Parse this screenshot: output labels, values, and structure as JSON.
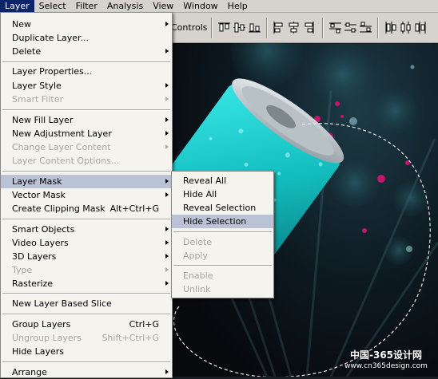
{
  "menubar": {
    "items": [
      {
        "label": "Layer"
      },
      {
        "label": "Select"
      },
      {
        "label": "Filter"
      },
      {
        "label": "Analysis"
      },
      {
        "label": "View"
      },
      {
        "label": "Window"
      },
      {
        "label": "Help"
      }
    ]
  },
  "options_bar": {
    "label_fragment": "Controls"
  },
  "layer_menu": {
    "items": [
      {
        "label": "New"
      },
      {
        "label": "Duplicate Layer..."
      },
      {
        "label": "Delete"
      },
      {
        "label": "Layer Properties..."
      },
      {
        "label": "Layer Style"
      },
      {
        "label": "Smart Filter"
      },
      {
        "label": "New Fill Layer"
      },
      {
        "label": "New Adjustment Layer"
      },
      {
        "label": "Change Layer Content"
      },
      {
        "label": "Layer Content Options..."
      },
      {
        "label": "Layer Mask"
      },
      {
        "label": "Vector Mask"
      },
      {
        "label": "Create Clipping Mask",
        "shortcut": "Alt+Ctrl+G"
      },
      {
        "label": "Smart Objects"
      },
      {
        "label": "Video Layers"
      },
      {
        "label": "3D Layers"
      },
      {
        "label": "Type"
      },
      {
        "label": "Rasterize"
      },
      {
        "label": "New Layer Based Slice"
      },
      {
        "label": "Group Layers",
        "shortcut": "Ctrl+G"
      },
      {
        "label": "Ungroup Layers",
        "shortcut": "Shift+Ctrl+G"
      },
      {
        "label": "Hide Layers"
      },
      {
        "label": "Arrange"
      }
    ]
  },
  "layer_mask_submenu": {
    "items": [
      {
        "label": "Reveal All"
      },
      {
        "label": "Hide All"
      },
      {
        "label": "Reveal Selection"
      },
      {
        "label": "Hide Selection"
      },
      {
        "label": "Delete"
      },
      {
        "label": "Apply"
      },
      {
        "label": "Enable"
      },
      {
        "label": "Unlink"
      }
    ]
  },
  "watermark": {
    "line1": "中国-365设计网",
    "line2": "www.cn365design.com"
  },
  "colors": {
    "menu_bg": "#f4f3ee",
    "highlight": "#b9c3d5",
    "menubar_active": "#0a246a",
    "disabled_text": "#a8a7a3",
    "can_cyan": "#17c9c9"
  },
  "icons": [
    "align-top-icon",
    "align-vertical-center-icon",
    "align-bottom-icon",
    "align-left-icon",
    "align-horizontal-center-icon",
    "align-right-icon",
    "distribute-top-icon",
    "distribute-vertical-center-icon",
    "distribute-bottom-icon",
    "distribute-left-icon",
    "distribute-horizontal-center-icon",
    "distribute-right-icon",
    "submenu-arrow-icon"
  ]
}
